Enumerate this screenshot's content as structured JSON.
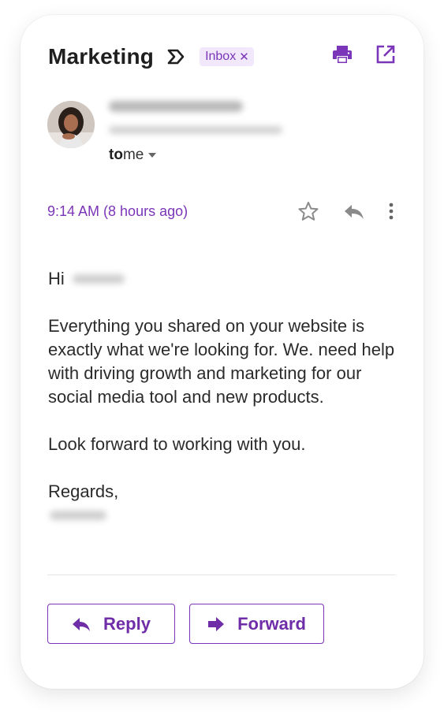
{
  "email": {
    "subject": "Marketing",
    "label_chip": "Inbox",
    "label_chip_remove": "✕",
    "recipient_prefix": "to",
    "recipient": "me",
    "time": "9:14 AM (8 hours ago)"
  },
  "body": {
    "greeting": "Hi",
    "paragraph1": "Everything you shared on your website is exactly what we're looking for. We. need help with driving growth and marketing for our social media tool and new products.",
    "paragraph2": "Look forward to working with you.",
    "signoff": "Regards,"
  },
  "actions": {
    "reply_label": "Reply",
    "forward_label": "Forward"
  },
  "colors": {
    "accent": "#7b35b8",
    "chip_bg": "#f1e9fb",
    "text": "#2b2b2b",
    "icon_gray": "#757575"
  },
  "icons": {
    "print": "print-icon",
    "open_external": "open-in-new-icon",
    "important": "important-label-icon",
    "star": "star-icon",
    "reply": "reply-icon",
    "more": "more-vert-icon",
    "forward": "forward-icon"
  }
}
